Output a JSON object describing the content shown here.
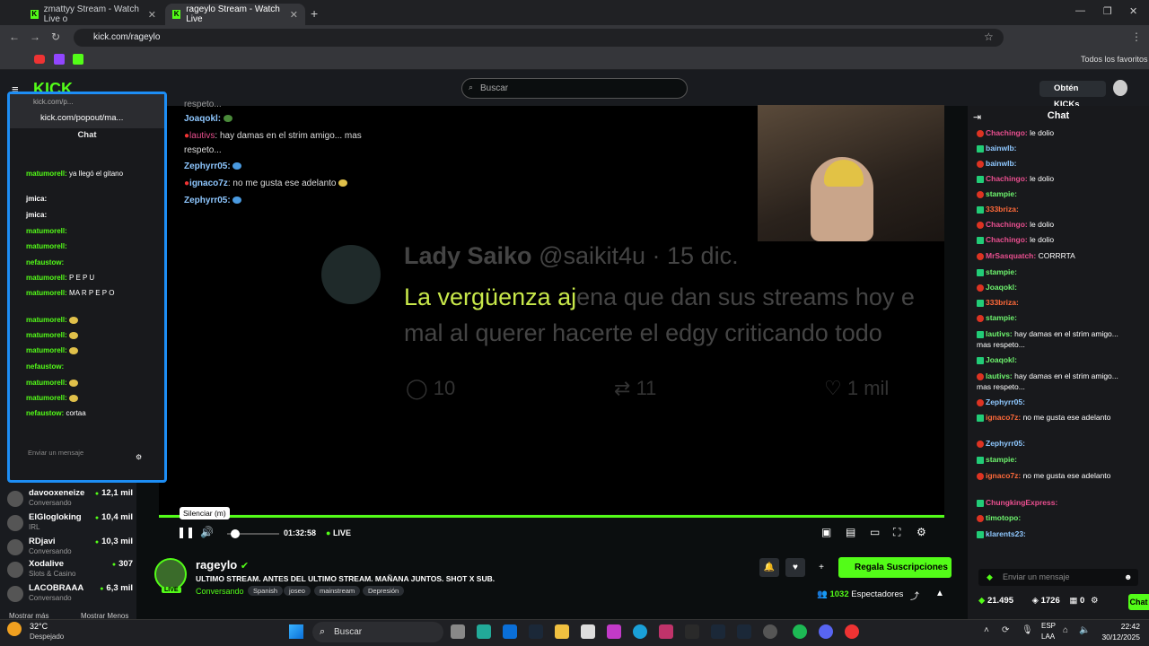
{
  "browser": {
    "tabs": [
      {
        "title": "zmattyy Stream - Watch Live o",
        "active": false
      },
      {
        "title": "rageylo Stream - Watch Live",
        "active": true
      }
    ],
    "url": "kick.com/rageylo",
    "bookmarks_all": "Todos los favoritos"
  },
  "kick": {
    "search_placeholder": "Buscar",
    "get_kicks": "Obtén KICKs"
  },
  "sidebar": {
    "streamers": [
      {
        "name": "davooxeneize",
        "category": "Conversando",
        "viewers": "12,1 mil"
      },
      {
        "name": "ElGlogloking",
        "category": "IRL",
        "viewers": "10,4 mil"
      },
      {
        "name": "RDjavi",
        "category": "Conversando",
        "viewers": "10,3 mil"
      },
      {
        "name": "Xodalive",
        "category": "Slots & Casino",
        "viewers": "307"
      },
      {
        "name": "LACOBRAAA",
        "category": "Conversando",
        "viewers": "6,3 mil"
      }
    ],
    "show_more": "Mostrar más",
    "show_less": "Mostrar Menos"
  },
  "video": {
    "overlay_chat": [
      {
        "user": "respeto...",
        "text": ""
      },
      {
        "user": "Joaqokl:",
        "text": ""
      },
      {
        "user": "lautivs",
        "text": ": hay damas en el strim amigo... mas"
      },
      {
        "user": "",
        "text": "respeto..."
      },
      {
        "user": "Zephyrr05:",
        "text": ""
      },
      {
        "user": "ignaco7z",
        "text": ": no me gusta ese adelanto"
      },
      {
        "user": "Zephyrr05:",
        "text": ""
      }
    ],
    "tweet": {
      "name": "Lady Saiko",
      "handle": "@saikit4u · 15 dic.",
      "line1_highlight": "La vergüenza aj",
      "line1_rest": "ena que dan sus streams hoy e",
      "line2": "mal al querer hacerte el edgy criticando todo",
      "replies": "10",
      "retweets": "11",
      "likes": "1 mil"
    },
    "tooltip": "Silenciar (m)",
    "time": "01:32:58",
    "live_label": "LIVE",
    "progress_fraction": 1.0
  },
  "stream_info": {
    "name": "rageylo",
    "title": "ULTIMO STREAM. ANTES DEL ULTIMO STREAM. MAÑANA JUNTOS. SHOT X SUB.",
    "category": "Conversando",
    "tags": [
      "Spanish",
      "joseo",
      "mainstream",
      "Depresión"
    ],
    "live_badge": "LIVE",
    "subscribe_label": "Regala Suscripciones",
    "viewers_count": "1032",
    "viewers_label": "Espectadores"
  },
  "popout": {
    "window_title": "kick.com/p...",
    "url": "kick.com/popout/ma...",
    "chat_title": "Chat",
    "messages": [
      {
        "user": "matumorell:",
        "text": "ya llegó el gitano"
      },
      {
        "user": "jmica:",
        "text": ""
      },
      {
        "user": "jmica:",
        "text": ""
      },
      {
        "user": "matumorell:",
        "text": ""
      },
      {
        "user": "matumorell:",
        "text": ""
      },
      {
        "user": "nefaustow:",
        "text": ""
      },
      {
        "user": "matumorell:",
        "text": "P E P U"
      },
      {
        "user": "matumorell:",
        "text": "MA R P E P O"
      },
      {
        "user": "matumorell:",
        "text": ""
      },
      {
        "user": "matumorell:",
        "text": ""
      },
      {
        "user": "matumorell:",
        "text": ""
      },
      {
        "user": "nefaustow:",
        "text": ""
      },
      {
        "user": "matumorell:",
        "text": ""
      },
      {
        "user": "matumorell:",
        "text": ""
      },
      {
        "user": "nefaustow:",
        "text": "cortaa"
      }
    ],
    "input_placeholder": "Enviar un mensaje"
  },
  "chat": {
    "title": "Chat",
    "messages": [
      {
        "user": "Chachingo:",
        "text": "le dolio",
        "color": "pink"
      },
      {
        "user": "bainwlb:",
        "text": "",
        "color": "blue"
      },
      {
        "user": "bainwlb:",
        "text": "",
        "color": "blue"
      },
      {
        "user": "Chachingo:",
        "text": "le dolio",
        "color": "pink"
      },
      {
        "user": "stampie:",
        "text": "",
        "color": "green"
      },
      {
        "user": "333briza:",
        "text": "",
        "color": "red"
      },
      {
        "user": "Chachingo:",
        "text": "le dolio",
        "color": "pink"
      },
      {
        "user": "Chachingo:",
        "text": "le dolio",
        "color": "pink"
      },
      {
        "user": "MrSasquatch:",
        "text": "CORRRTA",
        "color": "pink"
      },
      {
        "user": "stampie:",
        "text": "",
        "color": "green"
      },
      {
        "user": "Joaqokl:",
        "text": "",
        "color": "green"
      },
      {
        "user": "333briza:",
        "text": "",
        "color": "red"
      },
      {
        "user": "stampie:",
        "text": "",
        "color": "green"
      },
      {
        "user": "lautivs:",
        "text": "hay damas en el strim amigo...",
        "color": "green"
      },
      {
        "user": "",
        "text": "mas respeto...",
        "color": "green"
      },
      {
        "user": "Joaqokl:",
        "text": "",
        "color": "green"
      },
      {
        "user": "lautivs:",
        "text": "hay damas en el strim amigo...",
        "color": "green"
      },
      {
        "user": "",
        "text": "mas respeto...",
        "color": "green"
      },
      {
        "user": "Zephyrr05:",
        "text": "",
        "color": "blue"
      },
      {
        "user": "ignaco7z:",
        "text": "no me gusta ese adelanto",
        "color": "red"
      },
      {
        "user": "Zephyrr05:",
        "text": "",
        "color": "blue"
      },
      {
        "user": "stampie:",
        "text": "",
        "color": "green"
      },
      {
        "user": "ignaco7z:",
        "text": "no me gusta ese adelanto",
        "color": "red"
      },
      {
        "user": "ChungkingExpress:",
        "text": "",
        "color": "pink"
      },
      {
        "user": "timotopo:",
        "text": "",
        "color": "green"
      },
      {
        "user": "klarents23:",
        "text": "",
        "color": "blue"
      }
    ],
    "input_placeholder": "Enviar un mensaje",
    "kicks": "21.495",
    "stat2": "1726",
    "stat3": "0",
    "send_label": "Chat"
  },
  "taskbar": {
    "weather_temp": "32°C",
    "weather_desc": "Despejado",
    "search": "Buscar",
    "lang": "ESP",
    "lang2": "LAA",
    "time": "22:42",
    "date": "30/12/2025"
  }
}
